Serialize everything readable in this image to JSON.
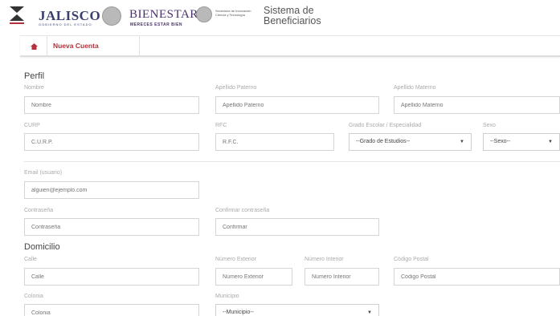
{
  "header": {
    "logo1_label": "JALISCO",
    "logo1_sub": "GOBIERNO DEL ESTADO",
    "logo2_label": "BIENESTAR",
    "logo2_sub": "MERECES ESTAR BIEN",
    "logo3_label": "Secretaría de Innovación Ciencia y Tecnología",
    "app_title_line1": "Sistema de",
    "app_title_line2": "Beneficiarios"
  },
  "breadcrumb": {
    "active": "Nueva Cuenta"
  },
  "perfil": {
    "title": "Perfil",
    "nombre": {
      "label": "Nombre",
      "placeholder": "Nombre"
    },
    "apellido_paterno": {
      "label": "Apellido Paterno",
      "placeholder": "Apellido Paterno"
    },
    "apellido_materno": {
      "label": "Apellido Materno",
      "placeholder": "Apellido Materno"
    },
    "curp": {
      "label": "CURP",
      "placeholder": "C.U.R.P."
    },
    "rfc": {
      "label": "RFC",
      "placeholder": "R.F.C."
    },
    "grado": {
      "label": "Grado Escolar / Especialidad",
      "selected": "--Grado de Estudios--"
    },
    "sexo": {
      "label": "Sexo",
      "selected": "--Sexo--"
    },
    "email": {
      "label": "Email (usuario)",
      "placeholder": "alguien@ejemplo.com"
    },
    "contrasena": {
      "label": "Contraseña",
      "placeholder": "Contraseña"
    },
    "confirmar": {
      "label": "Confirmar contraseña",
      "placeholder": "Confirmar"
    }
  },
  "domicilio": {
    "title": "Domicilio",
    "calle": {
      "label": "Calle",
      "placeholder": "Calle"
    },
    "num_ext": {
      "label": "Número Exterior",
      "placeholder": "Número Exterior"
    },
    "num_int": {
      "label": "Número Interior",
      "placeholder": "Número Interior"
    },
    "cp": {
      "label": "Código Postal",
      "placeholder": "Código Postal"
    },
    "colonia": {
      "label": "Colonia",
      "placeholder": "Colonia"
    },
    "municipio": {
      "label": "Municipio",
      "selected": "--Municipio--"
    }
  },
  "colors": {
    "accent": "#b3313a",
    "border": "#d5d5d5",
    "label": "#aaaaaa"
  }
}
